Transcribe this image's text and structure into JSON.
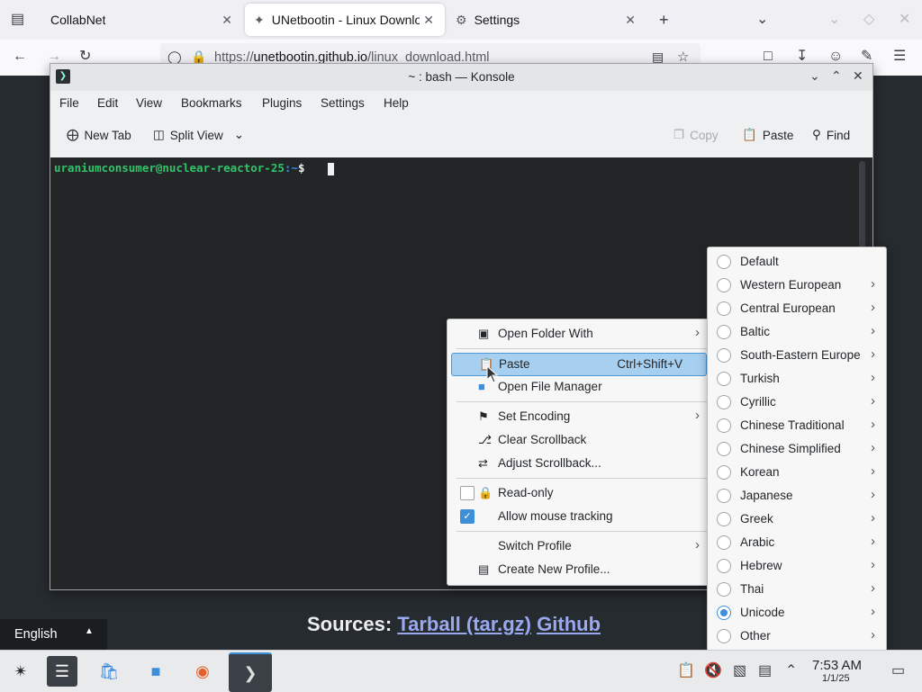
{
  "browser": {
    "tabs": [
      {
        "title": "CollabNet"
      },
      {
        "title": "UNetbootin - Linux Downlo"
      },
      {
        "title": "Settings"
      }
    ],
    "url_prefix": "https://",
    "url_domain": "unetbootin.github.io",
    "url_path": "/linux_download.html"
  },
  "page": {
    "sources_label": "Sources:",
    "link_tarball": "Tarball (tar.gz)",
    "link_github": "Github"
  },
  "konsole": {
    "title": "~ : bash — Konsole",
    "menus": [
      "File",
      "Edit",
      "View",
      "Bookmarks",
      "Plugins",
      "Settings",
      "Help"
    ],
    "toolbar": {
      "new_tab": "New Tab",
      "split_view": "Split View",
      "copy": "Copy",
      "paste": "Paste",
      "find": "Find"
    },
    "prompt_user": "uraniumconsumer@nuclear-reactor-25",
    "prompt_dir": ":~",
    "prompt_symbol": "$"
  },
  "context_menu": {
    "open_folder_with": "Open Folder With",
    "paste": "Paste",
    "paste_shortcut": "Ctrl+Shift+V",
    "open_file_manager": "Open File Manager",
    "set_encoding": "Set Encoding",
    "clear_scrollback": "Clear Scrollback",
    "adjust_scrollback": "Adjust Scrollback...",
    "read_only": "Read-only",
    "allow_mouse_tracking": "Allow mouse tracking",
    "switch_profile": "Switch Profile",
    "create_new_profile": "Create New Profile..."
  },
  "encoding_menu": {
    "items": [
      "Default",
      "Western European",
      "Central European",
      "Baltic",
      "South-Eastern Europe",
      "Turkish",
      "Cyrillic",
      "Chinese Traditional",
      "Chinese Simplified",
      "Korean",
      "Japanese",
      "Greek",
      "Arabic",
      "Hebrew",
      "Thai",
      "Unicode",
      "Other"
    ],
    "selected": "Unicode"
  },
  "taskbar": {
    "language": "English",
    "time": "7:53 AM",
    "date": "1/1/25"
  }
}
